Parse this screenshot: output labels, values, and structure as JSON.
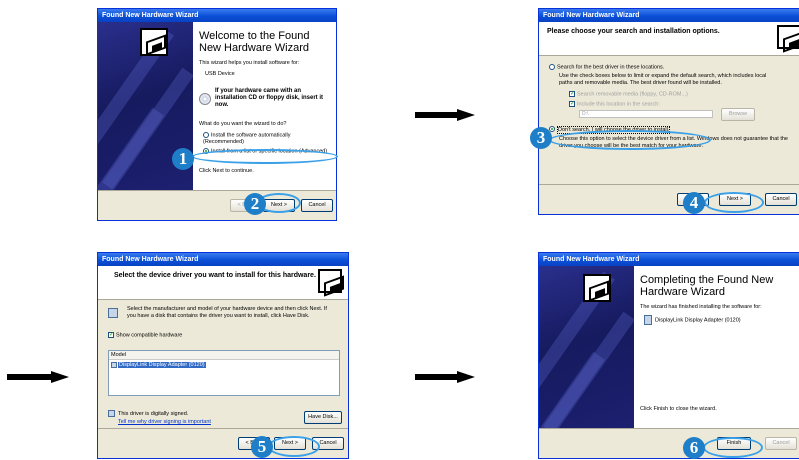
{
  "dialog1": {
    "title": "Found New Hardware Wizard",
    "heading": "Welcome to the Found New Hardware Wizard",
    "intro": "This wizard helps you install software for:",
    "device": "USB Device",
    "cd_prompt": "If your hardware came with an installation CD or floppy disk, insert it now.",
    "question": "What do you want the wizard to do?",
    "option_auto": "Install the software automatically (Recommended)",
    "option_list": "Install from a list or specific location (Advanced)",
    "continue_text": "Click Next to continue.",
    "back_label": "< Back",
    "next_label": "Next >",
    "cancel_label": "Cancel"
  },
  "dialog2": {
    "title": "Found New Hardware Wizard",
    "heading": "Please choose your search and installation options.",
    "option_search": "Search for the best driver in these locations.",
    "search_desc": "Use the check boxes below to limit or expand the default search, which includes local paths and removable media. The best driver found will be installed.",
    "check_removable": "Search removable media (floppy, CD-ROM...)",
    "check_include": "Include this location in the search:",
    "location_value": "D:\\",
    "browse_label": "Browse",
    "option_dont_search": "Don't search. I will choose the driver to install.",
    "dont_search_desc": "Choose this option to select the device driver from a list. Windows does not guarantee that the driver you choose will be the best match for your hardware.",
    "back_label": "< Back",
    "next_label": "Next >",
    "cancel_label": "Cancel"
  },
  "dialog3": {
    "title": "Found New Hardware Wizard",
    "heading": "Select the device driver you want to install for this hardware.",
    "desc": "Select the manufacturer and model of your hardware device and then click Next. If you have a disk that contains the driver you want to install, click Have Disk.",
    "show_compatible": "Show compatible hardware",
    "model_header": "Model",
    "model_item": "DisplayLink Display Adapter (0120)",
    "signed_text": "This driver is digitally signed.",
    "signing_link": "Tell me why driver signing is important",
    "have_disk_label": "Have Disk...",
    "back_label": "< Back",
    "next_label": "Next >",
    "cancel_label": "Cancel"
  },
  "dialog4": {
    "title": "Found New Hardware Wizard",
    "heading": "Completing the Found New Hardware Wizard",
    "finished_text": "The wizard has finished installing the software for:",
    "device": "DisplayLink Display Adapter (0120)",
    "close_text": "Click Finish to close the wizard.",
    "finish_label": "Finish",
    "cancel_label": "Cancel"
  },
  "steps": [
    "1",
    "2",
    "3",
    "4",
    "5",
    "6"
  ],
  "colors": {
    "callout": "#1e7fc8",
    "ring": "#3aa0e8",
    "titlebar": "#0a4fd6",
    "dialog_bg": "#ece9d8"
  }
}
